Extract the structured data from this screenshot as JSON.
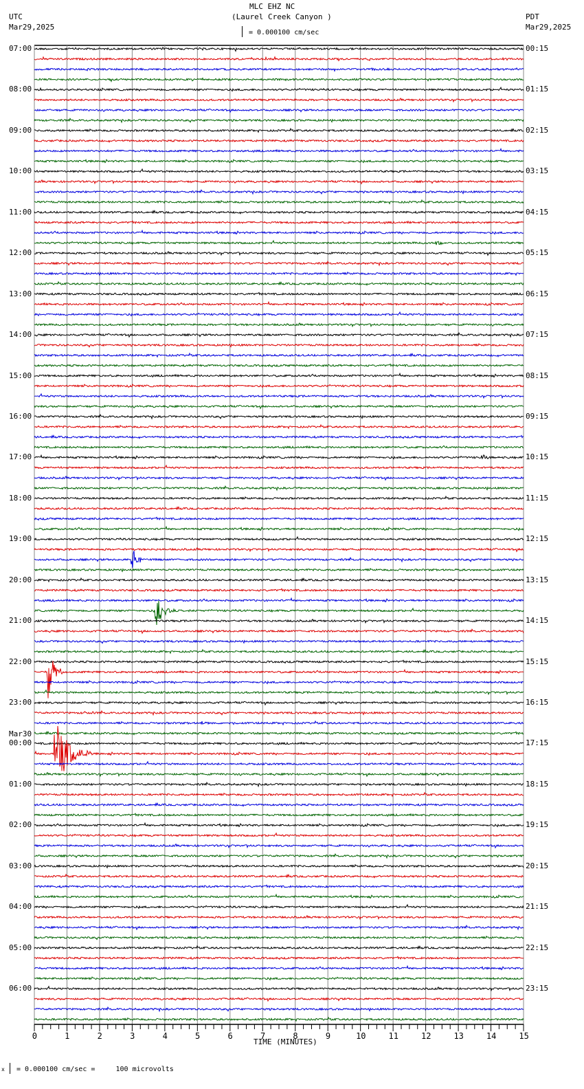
{
  "header": {
    "title": "MLC EHZ NC",
    "subtitle": "(Laurel Creek Canyon )",
    "left_tz": "UTC",
    "left_date": "Mar29,2025",
    "right_tz": "PDT",
    "right_date": "Mar29,2025",
    "scale_text": "= 0.000100 cm/sec"
  },
  "footer": {
    "scale_text": "= 0.000100 cm/sec =     100 microvolts",
    "marker": "x"
  },
  "chart_data": {
    "type": "line",
    "title": "MLC EHZ NC (Laurel Creek Canyon )",
    "xlabel": "TIME (MINUTES)",
    "xlim": [
      0,
      15
    ],
    "x_ticks": [
      "0",
      "1",
      "2",
      "3",
      "4",
      "5",
      "6",
      "7",
      "8",
      "9",
      "10",
      "11",
      "12",
      "13",
      "14",
      "15"
    ],
    "grid": true,
    "trace_colors": [
      "#000000",
      "#dd0000",
      "#0000dd",
      "#006400"
    ],
    "rows_per_hour": 4,
    "row_count": 96,
    "left_labels": [
      "07:00",
      "08:00",
      "09:00",
      "10:00",
      "11:00",
      "12:00",
      "13:00",
      "14:00",
      "15:00",
      "16:00",
      "17:00",
      "18:00",
      "19:00",
      "20:00",
      "21:00",
      "22:00",
      "23:00",
      "00:00",
      "01:00",
      "02:00",
      "03:00",
      "04:00",
      "05:00",
      "06:00"
    ],
    "left_date_change": {
      "hour_index": 17,
      "label": "Mar30"
    },
    "right_labels": [
      "00:15",
      "01:15",
      "02:15",
      "03:15",
      "04:15",
      "05:15",
      "06:15",
      "07:15",
      "08:15",
      "09:15",
      "10:15",
      "11:15",
      "12:15",
      "13:15",
      "14:15",
      "15:15",
      "16:15",
      "17:15",
      "18:15",
      "19:15",
      "20:15",
      "21:15",
      "22:15",
      "23:15"
    ],
    "events": [
      {
        "row": 19,
        "minute": 12.3,
        "amplitude": 6,
        "duration": 0.3
      },
      {
        "row": 40,
        "minute": 13.7,
        "amplitude": 5,
        "duration": 0.4
      },
      {
        "row": 50,
        "minute": 2.95,
        "amplitude": 28,
        "duration": 0.4
      },
      {
        "row": 55,
        "minute": 3.7,
        "amplitude": 30,
        "duration": 0.6
      },
      {
        "row": 61,
        "minute": 0.4,
        "amplitude": 45,
        "duration": 0.5
      },
      {
        "row": 65,
        "minute": 1.5,
        "amplitude": 3,
        "duration": 0.2
      },
      {
        "row": 66,
        "minute": 5.1,
        "amplitude": 4,
        "duration": 0.4
      },
      {
        "row": 69,
        "minute": 0.6,
        "amplitude": 55,
        "duration": 1.2
      },
      {
        "row": 72,
        "minute": 8.5,
        "amplitude": 3,
        "duration": 0.2
      }
    ]
  }
}
